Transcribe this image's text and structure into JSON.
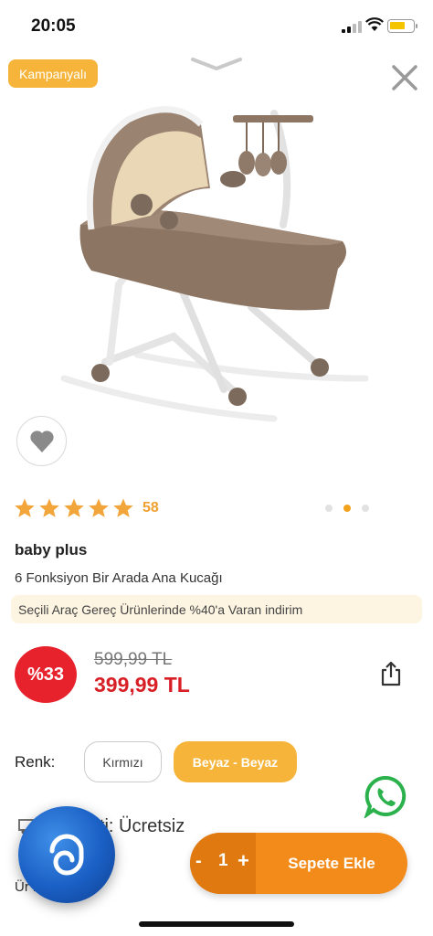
{
  "status_bar": {
    "time": "20:05",
    "battery_color": "#f5c400"
  },
  "header": {
    "campaign_badge": "Kampanyalı",
    "badge_color": "#f6b53a",
    "collapse_icon": "chevron-down-icon",
    "close_icon": "close-icon"
  },
  "product": {
    "image_icon": "baby-bouncer-cradle-image",
    "rating_stars": 5,
    "rating_count": "58",
    "pager_active_index": 1,
    "pager_total": 3,
    "brand": "baby plus",
    "name": "6 Fonksiyon Bir Arada Ana Kucağı",
    "promo": "Seçili Araç Gereç Ürünlerinde %40'a Varan indirim",
    "discount_badge": "%33",
    "old_price": "599,99 TL",
    "price": "399,99 TL",
    "price_color": "#d81f26"
  },
  "variant": {
    "label": "Renk:",
    "options": [
      {
        "label": "Kırmızı",
        "selected": false
      },
      {
        "label": "Beyaz - Beyaz",
        "selected": true
      }
    ]
  },
  "info": {
    "shipping_text": "o Ücreti: Ücretsiz",
    "return_text": "Ür              ması"
  },
  "cart": {
    "minus": "-",
    "quantity": "1",
    "plus": "+",
    "button_label": "Sepete Ekle",
    "accent": "#f28b1a"
  }
}
